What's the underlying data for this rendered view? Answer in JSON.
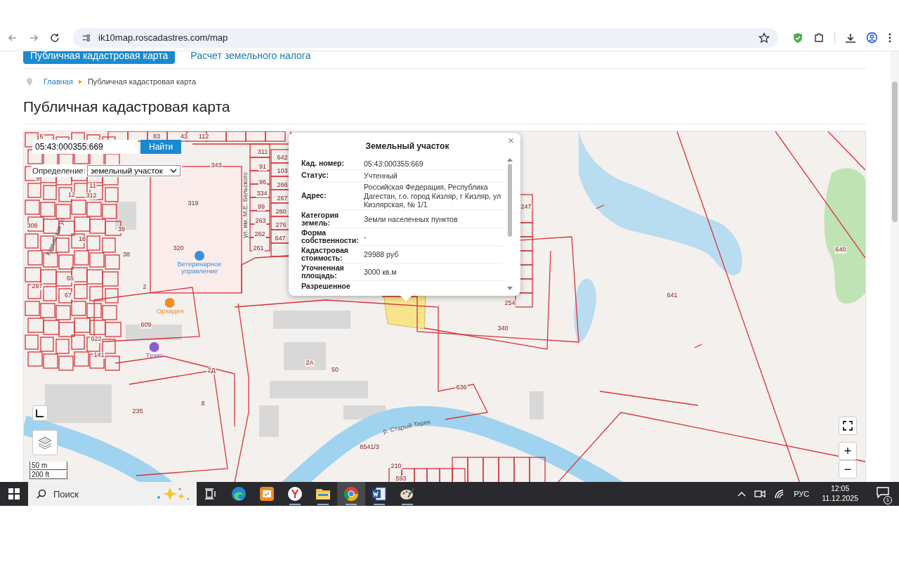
{
  "browser": {
    "url": "ik10map.roscadastres.com/map"
  },
  "nav_tabs": [
    {
      "label": "Публичная кадастровая карта",
      "selected": true
    },
    {
      "label": "Расчет земельного налога",
      "selected": false
    }
  ],
  "breadcrumb": {
    "home": "Главная",
    "current": "Публичная кадастровая карта"
  },
  "page_title": "Публичная кадастровая карта",
  "map": {
    "search": {
      "value": "05:43:000355:669",
      "button": "Найти"
    },
    "definition": {
      "label": "Определение:",
      "value": "земельный участок"
    },
    "labels": [
      "6",
      "83",
      "43",
      "112",
      "343",
      "319",
      "320",
      "39",
      "38",
      "18",
      "12",
      "312",
      "11",
      "9",
      "308",
      "297",
      "65",
      "67",
      "2",
      "609",
      "622",
      "141",
      "2Д",
      "2А",
      "50",
      "8",
      "235",
      "636",
      "8541/3",
      "210",
      "593",
      "340",
      "254",
      "247",
      "641",
      "640",
      "311",
      "91",
      "96",
      "334",
      "99",
      "263",
      "262",
      "261",
      "642",
      "103",
      "266",
      "267",
      "280",
      "276",
      "647"
    ],
    "streets": [
      "ул. им. М.Е. Бельского",
      "Кумыкская ул",
      "р. Старый Терек"
    ],
    "pois": [
      {
        "name": "Ветеринарное управление",
        "color": "#3b8fd9"
      },
      {
        "name": "Орхидея",
        "color": "#f08c2a"
      },
      {
        "name": "Тезис",
        "color": "#8a5cd0"
      }
    ],
    "scale": [
      "50 m",
      "200 ft"
    ],
    "zoom_in": "+",
    "zoom_out": "−"
  },
  "popup": {
    "title": "Земельный участок",
    "close": "×",
    "rows": [
      {
        "label": "Кад. номер:",
        "value": "05:43:000355:669"
      },
      {
        "label": "Статус:",
        "value": "Учтенный"
      },
      {
        "label": "Адрес:",
        "value": "Российская Федерация, Республика Дагестан, г.о. город Кизляр, г Кизляр, ул Кизлярская, № 1/1"
      },
      {
        "label": "Категория земель:",
        "value": "Земли населенных пунктов"
      },
      {
        "label": "Форма собственности:",
        "value": "-"
      },
      {
        "label": "Кадастровая стоимость:",
        "value": "29988 руб"
      },
      {
        "label": "Уточненная площадь:",
        "value": "3000 кв.м"
      },
      {
        "label": "Разрешенное",
        "value": ""
      }
    ]
  },
  "taskbar": {
    "search_placeholder": "Поиск",
    "language": "РУС",
    "time": "12:05",
    "date": "11.12.2025",
    "notifications": "1",
    "apps": [
      {
        "kind": "taskview",
        "running": false,
        "selected": false
      },
      {
        "kind": "edge",
        "running": false,
        "selected": false
      },
      {
        "kind": "todo",
        "running": false,
        "selected": false
      },
      {
        "kind": "yandex",
        "running": true,
        "selected": false
      },
      {
        "kind": "folder",
        "running": true,
        "selected": false
      },
      {
        "kind": "chrome",
        "running": true,
        "selected": true
      },
      {
        "kind": "word",
        "running": true,
        "selected": false
      },
      {
        "kind": "paint",
        "running": true,
        "selected": false
      }
    ]
  }
}
